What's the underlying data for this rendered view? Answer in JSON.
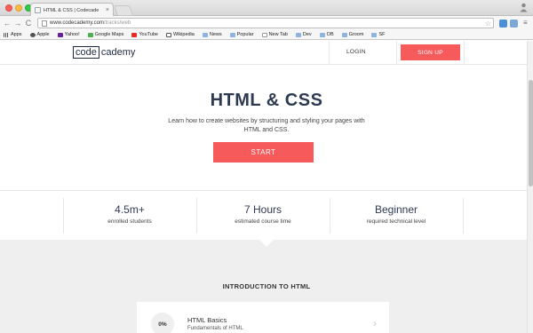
{
  "browser": {
    "tab_title": "HTML & CSS | Codecade",
    "tab_close": "×",
    "url_host": "www.codecademy.com",
    "url_path": "/tracks/web",
    "back_glyph": "←",
    "forward_glyph": "→",
    "reload_glyph": "C",
    "star_glyph": "☆",
    "menu_glyph": "≡",
    "bookmarks": [
      {
        "label": "Apps",
        "icon": "apps-grid-icon"
      },
      {
        "label": "Apple",
        "icon": "apple-icon"
      },
      {
        "label": "Yahoo!",
        "icon": "yahoo-icon"
      },
      {
        "label": "Google Maps",
        "icon": "google-maps-icon"
      },
      {
        "label": "YouTube",
        "icon": "youtube-icon"
      },
      {
        "label": "Wikipedia",
        "icon": "wikipedia-icon"
      },
      {
        "label": "News",
        "icon": "folder-icon"
      },
      {
        "label": "Popular",
        "icon": "folder-icon"
      },
      {
        "label": "New Tab",
        "icon": "page-icon"
      },
      {
        "label": "Dev",
        "icon": "folder-icon"
      },
      {
        "label": "OB",
        "icon": "folder-icon"
      },
      {
        "label": "Groom",
        "icon": "folder-icon"
      },
      {
        "label": "SF",
        "icon": "folder-icon"
      }
    ]
  },
  "header": {
    "logo_boxed": "code",
    "logo_rest": "cademy",
    "login_label": "LOGIN",
    "signup_label": "SIGN UP"
  },
  "hero": {
    "title": "HTML & CSS",
    "description": "Learn how to create websites by structuring and styling your pages with HTML and CSS.",
    "start_label": "START"
  },
  "stats": [
    {
      "value": "4.5m+",
      "label": "enrolled students"
    },
    {
      "value": "7 Hours",
      "label": "estimated course time"
    },
    {
      "value": "Beginner",
      "label": "required technical level"
    }
  ],
  "syllabus": {
    "section_title": "INTRODUCTION TO HTML",
    "course": {
      "progress": "0%",
      "name": "HTML Basics",
      "subtitle": "Fundamentals of HTML",
      "chevron": "›"
    }
  },
  "colors": {
    "accent": "#f65a5b",
    "navy": "#2d3a52",
    "section_bg": "#efefef"
  }
}
